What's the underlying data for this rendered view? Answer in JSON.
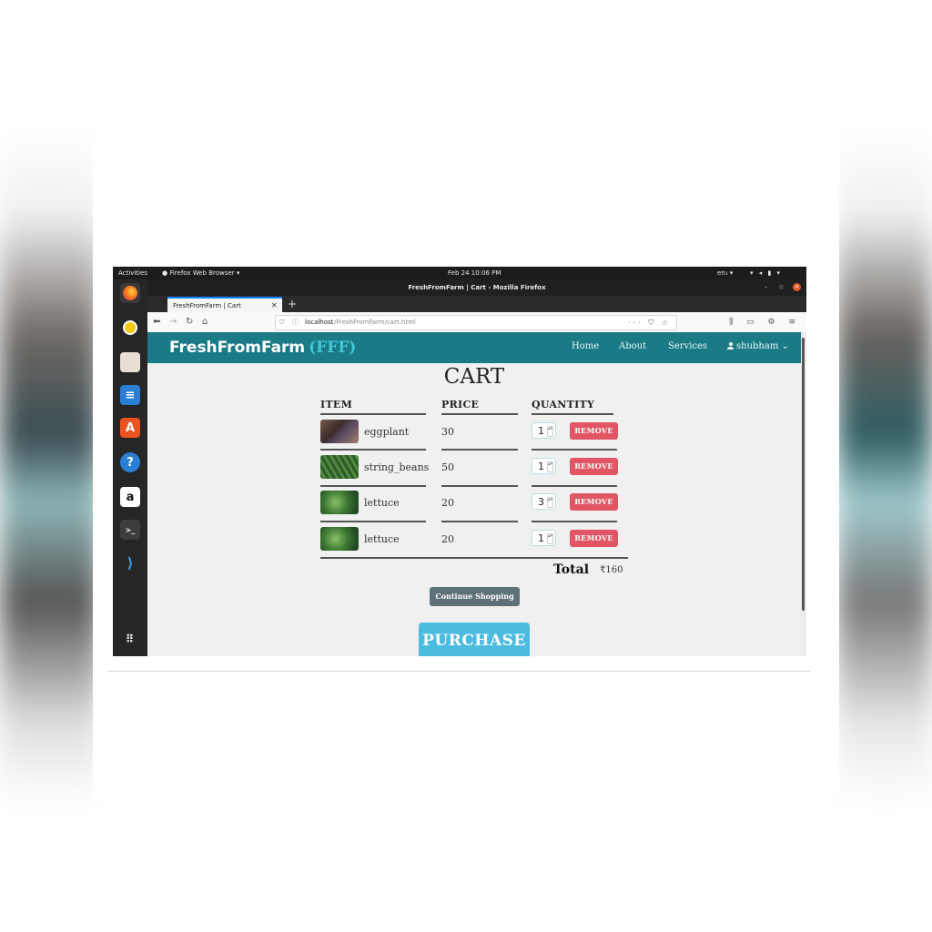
{
  "desktop": {
    "activities": "Activities",
    "app_name": "Firefox Web Browser ▾",
    "clock": "Feb 24  10:06 PM",
    "lang": "en₁ ▾",
    "tray": "▾ ◂ ▮ ▾"
  },
  "browser": {
    "window_title": "FreshFromFarm | Cart - Mozilla Firefox",
    "tab_title": "FreshFromFarm | Cart",
    "url_host": "localhost",
    "url_path": "/FreshFromFarm/cart.html"
  },
  "site": {
    "brand": "FreshFromFarm",
    "brand_abbr": "(FFF)",
    "nav": [
      "Home",
      "About",
      "Services"
    ],
    "user": "shubham ⌄"
  },
  "cart": {
    "title": "CART",
    "headers": [
      "ITEM",
      "PRICE",
      "QUANTITY"
    ],
    "rows": [
      {
        "name": "eggplant",
        "price": "30",
        "qty": "1"
      },
      {
        "name": "string_beans",
        "price": "50",
        "qty": "1"
      },
      {
        "name": "lettuce",
        "price": "20",
        "qty": "3"
      },
      {
        "name": "lettuce",
        "price": "20",
        "qty": "1"
      }
    ],
    "remove_label": "REMOVE",
    "total_label": "Total",
    "total_value": "₹160",
    "continue_label": "Continue Shopping",
    "purchase_label": "PURCHASE"
  },
  "colors": {
    "navbar": "#1a7b86",
    "brand_accent": "#43c8d6",
    "remove": "#e15564",
    "continue": "#5e7077",
    "purchase": "#4bbbe0"
  }
}
